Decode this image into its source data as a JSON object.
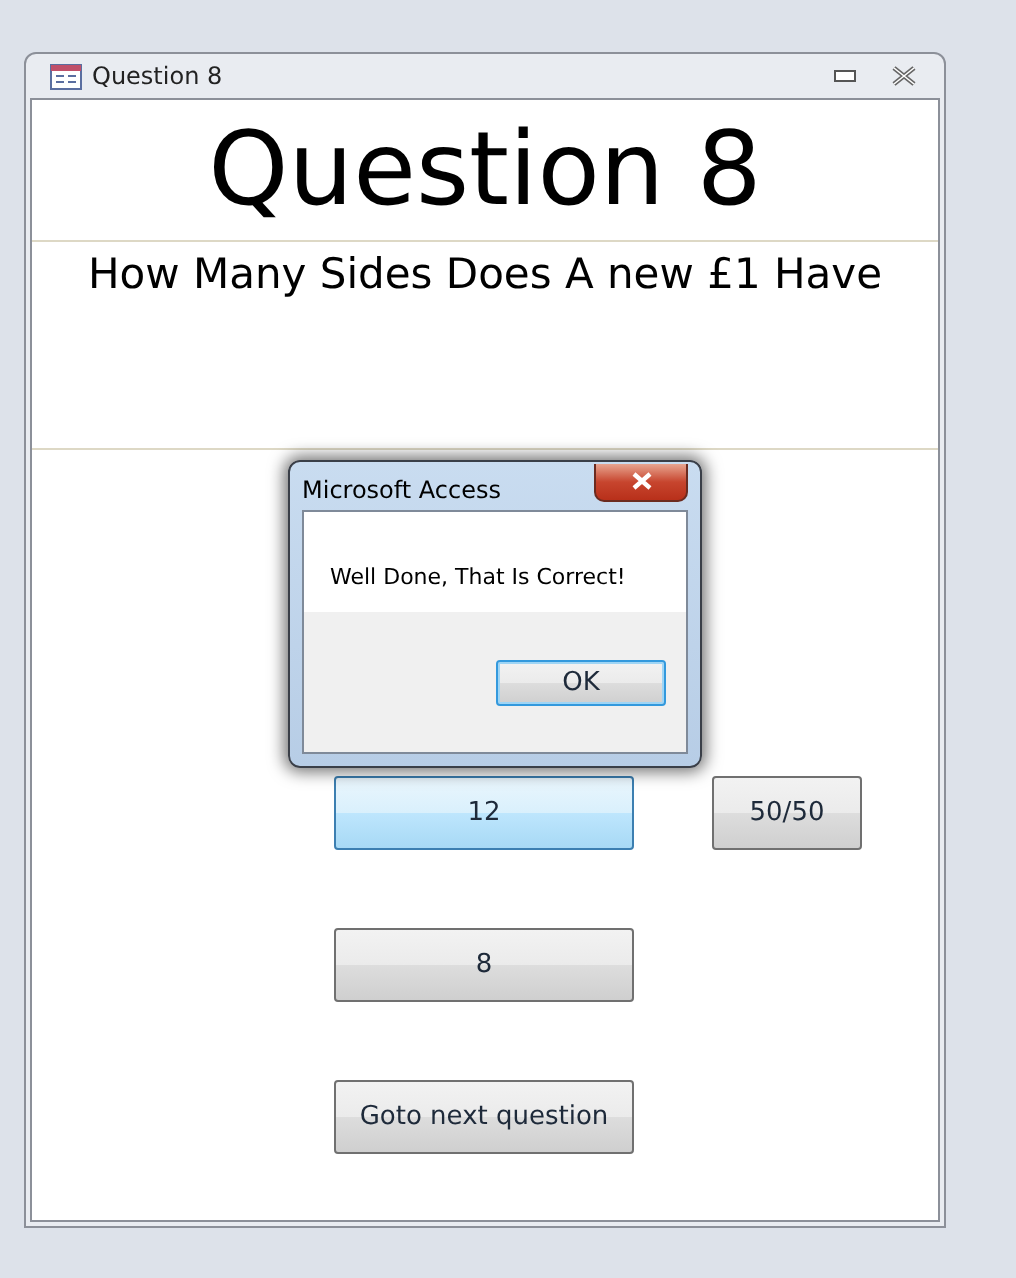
{
  "window": {
    "title": "Question 8"
  },
  "heading": "Question 8",
  "question": "How Many Sides Does A new £1 Have",
  "answer_buttons": [
    {
      "label": "12",
      "hovered": true
    },
    {
      "label": "8",
      "hovered": false
    }
  ],
  "lifeline_button": {
    "label": "50/50"
  },
  "next_button": {
    "label": "Goto next question"
  },
  "dialog": {
    "title": "Microsoft Access",
    "message": "Well Done, That Is Correct!",
    "button": {
      "label": "OK",
      "focused": true
    }
  }
}
